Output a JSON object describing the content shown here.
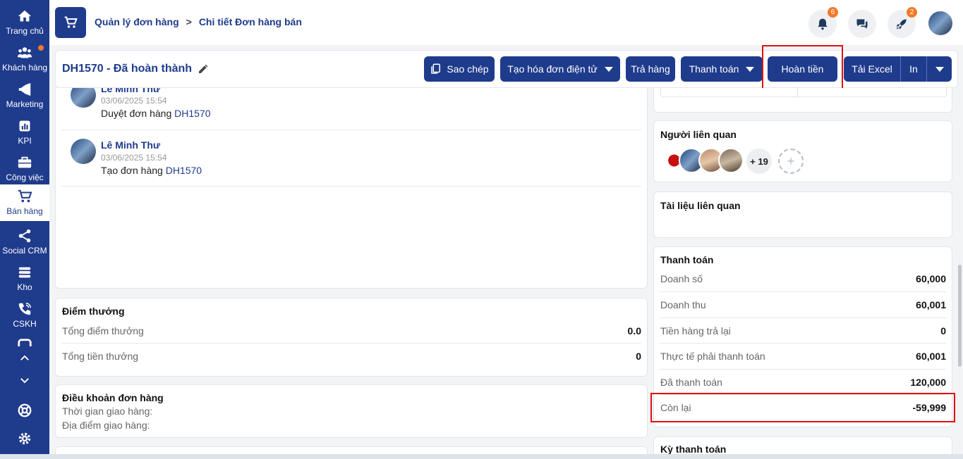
{
  "sidebar": {
    "items": [
      {
        "label": "Trang chủ",
        "icon": "home-icon"
      },
      {
        "label": "Khách hàng",
        "icon": "users-icon"
      },
      {
        "label": "Marketing",
        "icon": "megaphone-icon"
      },
      {
        "label": "KPI",
        "icon": "chart-icon"
      },
      {
        "label": "Công việc",
        "icon": "briefcase-icon"
      },
      {
        "label": "Bán hàng",
        "icon": "cart-icon"
      },
      {
        "label": "Social CRM",
        "icon": "share-icon"
      },
      {
        "label": "Kho",
        "icon": "stack-icon"
      },
      {
        "label": "CSKH",
        "icon": "phone-icon"
      }
    ]
  },
  "header": {
    "breadcrumb_parent": "Quản lý đơn hàng",
    "breadcrumb_sep": ">",
    "breadcrumb_current": "Chi tiết Đơn hàng bán",
    "notifications_count": "6",
    "rocket_count": "2"
  },
  "order": {
    "title": "DH1570 - Đã hoàn thành",
    "buttons": {
      "copy": "Sao chép",
      "einvoice": "Tạo hóa đơn điện tử",
      "return": "Trả hàng",
      "payment": "Thanh toán",
      "refund": "Hoàn tiền",
      "excel": "Tải Excel",
      "print": "In"
    }
  },
  "activity": [
    {
      "name": "Lê Minh Thư",
      "time": "03/06/2025 15:54",
      "text": "Duyệt đơn hàng ",
      "link": "DH1570"
    },
    {
      "name": "Lê Minh Thư",
      "time": "03/06/2025 15:54",
      "text": "Tạo đơn hàng ",
      "link": "DH1570"
    }
  ],
  "points": {
    "title": "Điểm thưởng",
    "rows": [
      {
        "label": "Tổng điểm thưởng",
        "value": "0.0"
      },
      {
        "label": "Tổng tiền thưởng",
        "value": "0"
      }
    ]
  },
  "terms": {
    "title": "Điều khoản đơn hàng",
    "delivery_time": "Thời gian giao hàng:",
    "delivery_place": "Địa điểm giao hàng:"
  },
  "related_people": {
    "title": "Người liên quan",
    "more": "+ 19",
    "add": "+"
  },
  "related_docs": {
    "title": "Tài liệu liên quan"
  },
  "payment": {
    "title": "Thanh toán",
    "rows": [
      {
        "label": "Doanh số",
        "value": "60,000"
      },
      {
        "label": "Doanh thu",
        "value": "60,001"
      },
      {
        "label": "Tiền hàng trả lại",
        "value": "0"
      },
      {
        "label": "Thực tế phải thanh toán",
        "value": "60,001"
      },
      {
        "label": "Đã thanh toán",
        "value": "120,000"
      },
      {
        "label": "Còn lại",
        "value": "-59,999"
      }
    ]
  },
  "payment_terms": {
    "title": "Kỳ thanh toán"
  },
  "colors": {
    "primary": "#1f3b8c",
    "accent": "#f07a2a",
    "highlight": "#e01010"
  }
}
